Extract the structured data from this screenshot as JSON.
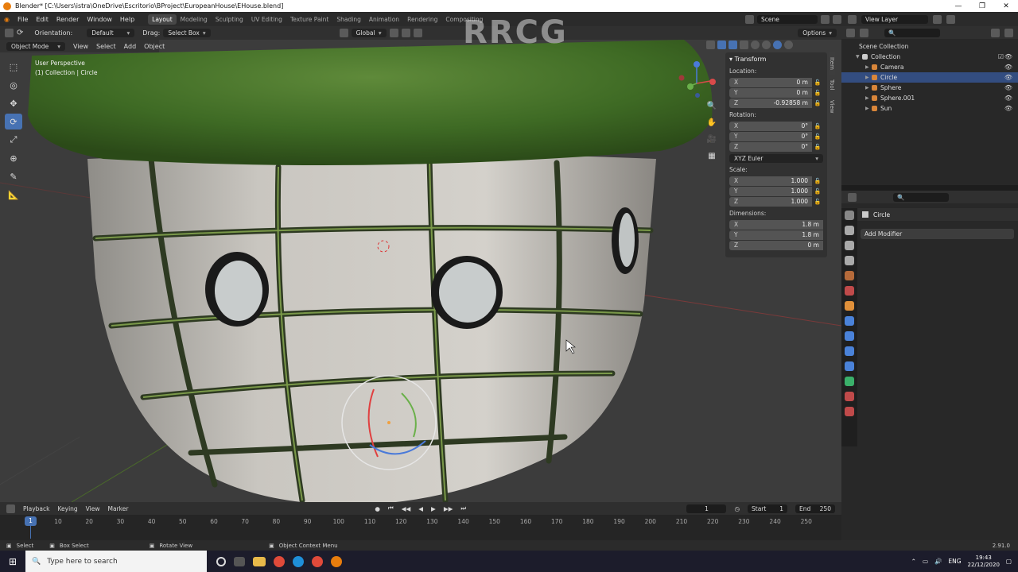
{
  "window": {
    "title": "Blender* [C:\\Users\\istra\\OneDrive\\Escritorio\\BProject\\EuropeanHouse\\EHouse.blend]",
    "controls": [
      "—",
      "❐",
      "✕"
    ]
  },
  "menu": [
    "File",
    "Edit",
    "Render",
    "Window",
    "Help"
  ],
  "workspaces": [
    {
      "label": "Layout",
      "active": true
    },
    {
      "label": "Modeling",
      "active": false
    },
    {
      "label": "Sculpting",
      "active": false
    },
    {
      "label": "UV Editing",
      "active": false
    },
    {
      "label": "Texture Paint",
      "active": false
    },
    {
      "label": "Shading",
      "active": false
    },
    {
      "label": "Animation",
      "active": false
    },
    {
      "label": "Rendering",
      "active": false
    },
    {
      "label": "Compositing",
      "active": false
    }
  ],
  "scene": {
    "name": "Scene",
    "view_layer": "View Layer"
  },
  "viewport_header": {
    "orientation_label": "Orientation:",
    "orientation_value": "Default",
    "drag_label": "Drag:",
    "drag_value": "Select Box",
    "transform_orientation": "Global",
    "options": "Options"
  },
  "viewport_menu": {
    "mode": "Object Mode",
    "items": [
      "View",
      "Select",
      "Add",
      "Object"
    ]
  },
  "viewport_info": {
    "perspective": "User Perspective",
    "collection": "(1) Collection | Circle"
  },
  "transform_panel": {
    "title": "Transform",
    "location_label": "Location:",
    "location": {
      "x": "0 m",
      "y": "0 m",
      "z": "-0.92858 m"
    },
    "rotation_label": "Rotation:",
    "rotation": {
      "x": "0°",
      "y": "0°",
      "z": "0°"
    },
    "rotation_mode": "XYZ Euler",
    "scale_label": "Scale:",
    "scale": {
      "x": "1.000",
      "y": "1.000",
      "z": "1.000"
    },
    "dimensions_label": "Dimensions:",
    "dimensions": {
      "x": "1.8 m",
      "y": "1.8 m",
      "z": "0 m"
    }
  },
  "side_tabs": [
    "Item",
    "Tool",
    "View"
  ],
  "outliner": {
    "root": "Scene Collection",
    "collection": "Collection",
    "items": [
      {
        "name": "Camera",
        "color": "#d9863a",
        "selected": false
      },
      {
        "name": "Circle",
        "color": "#d9863a",
        "selected": true
      },
      {
        "name": "Sphere",
        "color": "#d9863a",
        "selected": false
      },
      {
        "name": "Sphere.001",
        "color": "#d9863a",
        "selected": false
      },
      {
        "name": "Sun",
        "color": "#d9863a",
        "selected": false
      }
    ]
  },
  "properties": {
    "object_name": "Circle",
    "add_modifier": "Add Modifier"
  },
  "timeline": {
    "menus": [
      "Playback",
      "Keying",
      "View",
      "Marker"
    ],
    "current_frame": "1",
    "start_label": "Start",
    "start": "1",
    "end_label": "End",
    "end": "250",
    "ticks": [
      "10",
      "20",
      "30",
      "40",
      "50",
      "60",
      "70",
      "80",
      "90",
      "100",
      "110",
      "120",
      "130",
      "140",
      "150",
      "160",
      "170",
      "180",
      "190",
      "200",
      "210",
      "220",
      "230",
      "240",
      "250"
    ],
    "marker": "1"
  },
  "status": {
    "select": "Select",
    "box_select": "Box Select",
    "rotate": "Rotate View",
    "context": "Object Context Menu",
    "version": "2.91.0"
  },
  "taskbar": {
    "search_placeholder": "Type here to search",
    "lang": "ENG",
    "time": "19:43",
    "date": "22/12/2020"
  },
  "watermark": "RRCG"
}
